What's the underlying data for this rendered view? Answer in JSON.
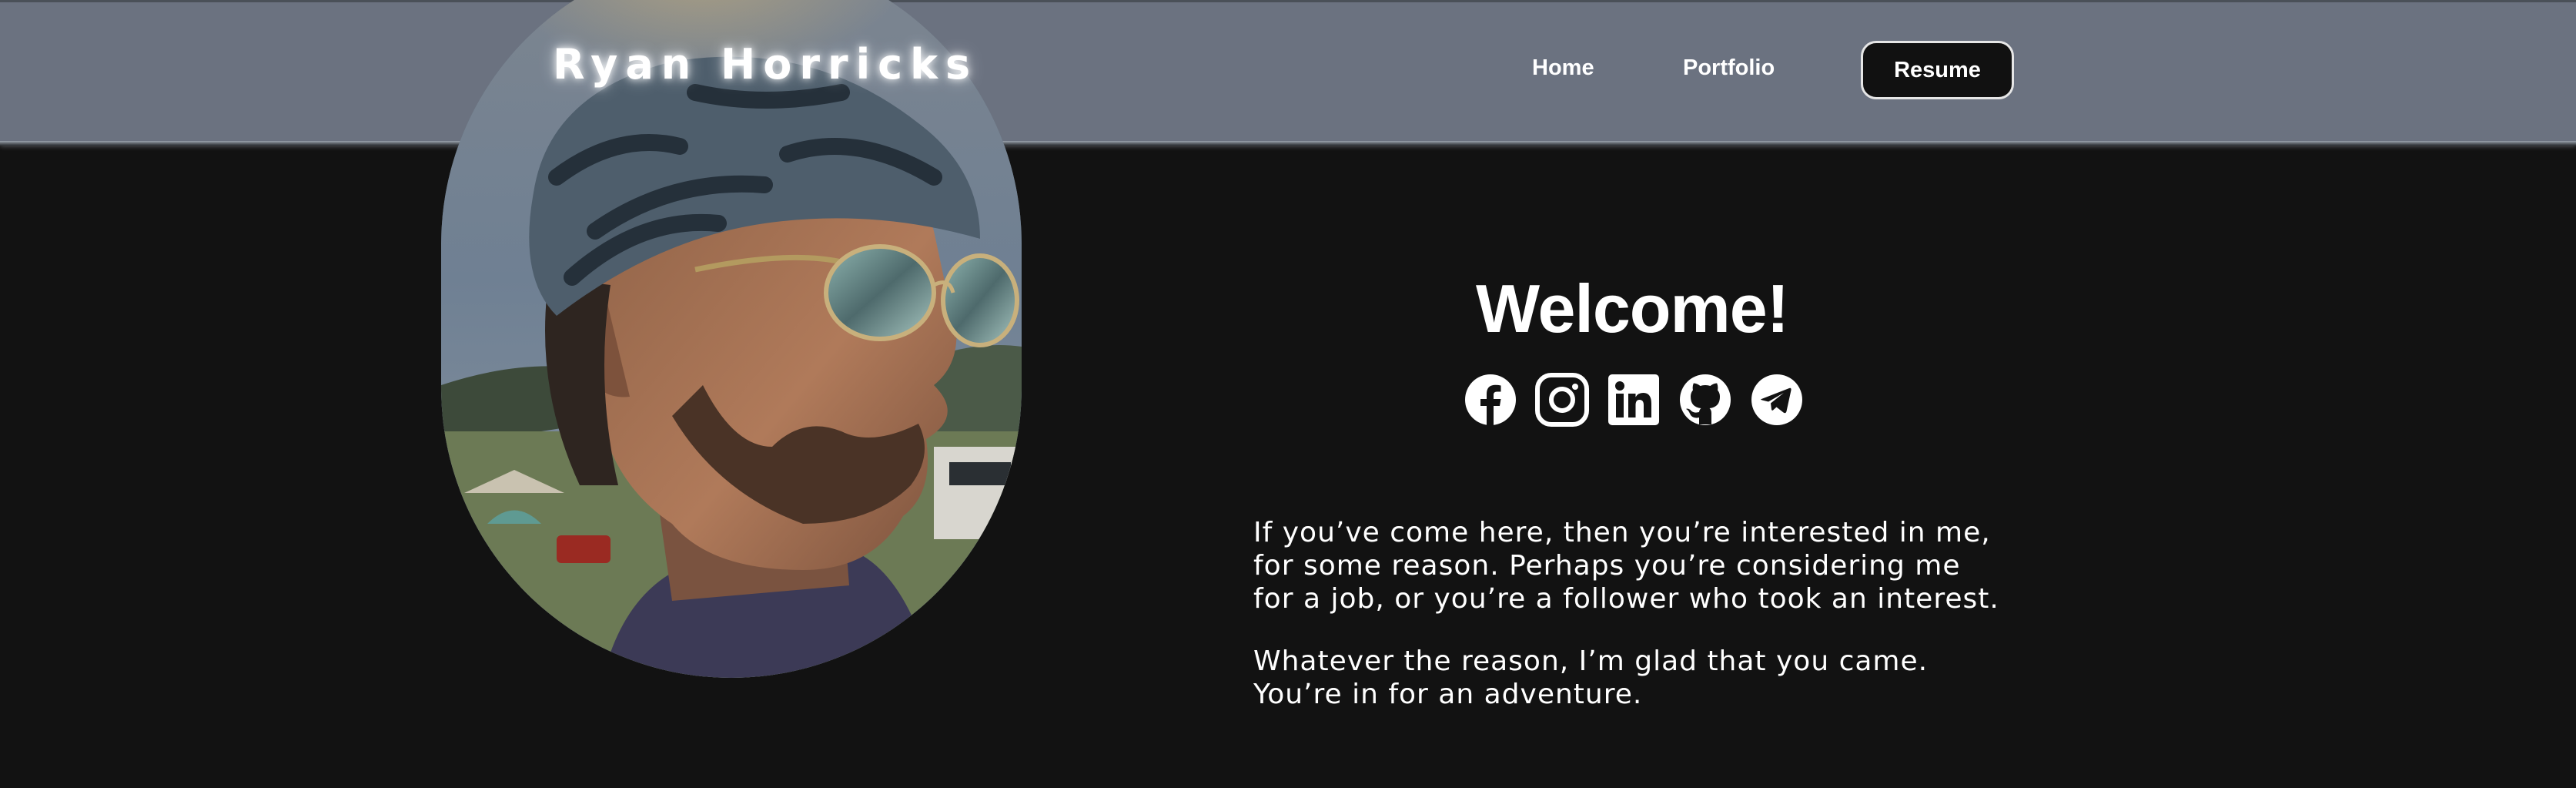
{
  "header": {
    "site_title": "Ryan Horricks",
    "nav": {
      "home": "Home",
      "portfolio": "Portfolio",
      "resume": "Resume"
    },
    "background_color": "#6b7280"
  },
  "main": {
    "welcome_heading": "Welcome!",
    "social_icons": [
      "facebook-icon",
      "instagram-icon",
      "linkedin-icon",
      "github-icon",
      "telegram-icon"
    ],
    "intro_paragraph_1": "If you’ve come here, then you’re interested in me,\nfor some reason. Perhaps you’re considering me\nfor a job, or you’re a follower who took an interest.",
    "intro_paragraph_2": "Whatever the reason, I’m glad that you came.\nYou’re in for an adventure.",
    "background_color": "#121212"
  }
}
